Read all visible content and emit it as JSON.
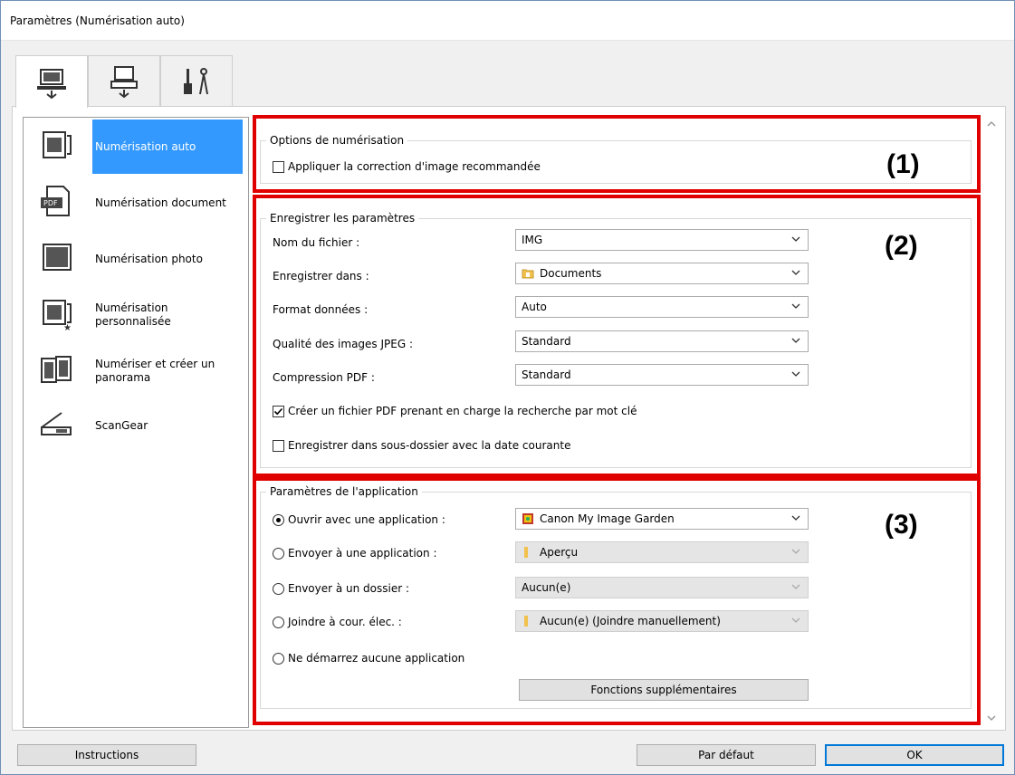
{
  "window": {
    "title": "Paramètres (Numérisation auto)"
  },
  "tabs": [
    {
      "icon": "computer-scan-icon",
      "active": true
    },
    {
      "icon": "scanner-icon",
      "active": false
    },
    {
      "icon": "tools-icon",
      "active": false
    }
  ],
  "nav": {
    "items": [
      {
        "label": "Numérisation auto",
        "icon": "auto-scan-icon",
        "selected": true
      },
      {
        "label": "Numérisation document",
        "icon": "pdf-document-icon"
      },
      {
        "label": "Numérisation photo",
        "icon": "photo-icon"
      },
      {
        "label": "Numérisation personnalisée",
        "icon": "custom-scan-icon"
      },
      {
        "label": "Numériser et créer un panorama",
        "icon": "panorama-icon"
      },
      {
        "label": "ScanGear",
        "icon": "scangear-icon"
      }
    ]
  },
  "markers": {
    "one": "(1)",
    "two": "(2)",
    "three": "(3)"
  },
  "scan_options": {
    "title": "Options de numérisation",
    "apply_correction": {
      "label": "Appliquer la correction d'image recommandée",
      "checked": false
    }
  },
  "save_settings": {
    "title": "Enregistrer les paramètres",
    "file_name": {
      "label": "Nom du fichier :",
      "value": "IMG"
    },
    "save_in": {
      "label": "Enregistrer dans :",
      "value": "Documents"
    },
    "data_format": {
      "label": "Format données :",
      "value": "Auto"
    },
    "jpeg_quality": {
      "label": "Qualité des images JPEG :",
      "value": "Standard"
    },
    "pdf_compression": {
      "label": "Compression PDF :",
      "value": "Standard"
    },
    "keyword_pdf": {
      "label": "Créer un fichier PDF prenant en charge la recherche par mot clé",
      "checked": true
    },
    "subfolder": {
      "label": "Enregistrer dans sous-dossier avec la date courante",
      "checked": false
    }
  },
  "app_settings": {
    "title": "Paramètres de l'application",
    "open_with": {
      "label": "Ouvrir avec une application :",
      "value": "Canon My Image Garden",
      "selected": true
    },
    "send_app": {
      "label": "Envoyer à une application :",
      "value": "Aperçu"
    },
    "send_folder": {
      "label": "Envoyer à un dossier :",
      "value": "Aucun(e)"
    },
    "attach_email": {
      "label": "Joindre à cour. élec. :",
      "value": "Aucun(e) (Joindre manuellement)"
    },
    "no_app": {
      "label": "Ne démarrez aucune application"
    },
    "more_functions": "Fonctions supplémentaires"
  },
  "footer": {
    "instructions": "Instructions",
    "defaults": "Par défaut",
    "ok": "OK"
  },
  "colors": {
    "accent": "#3399ff",
    "highlight_red": "#e00000",
    "default_button_border": "#0078d7"
  }
}
